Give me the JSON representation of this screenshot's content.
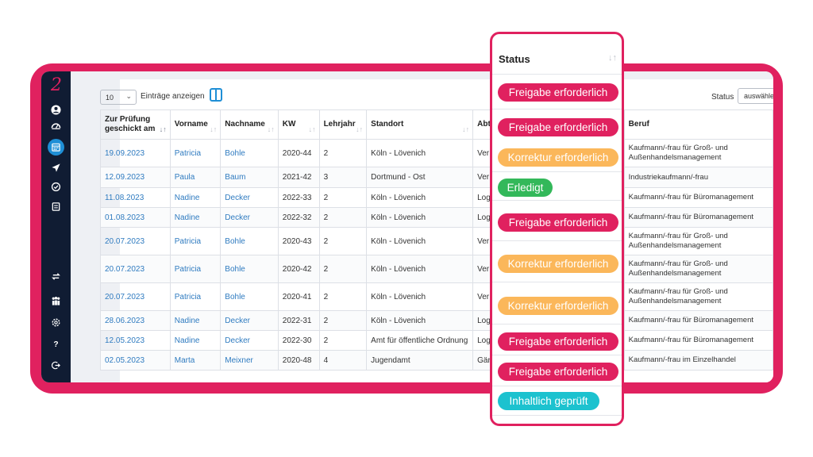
{
  "toolbar": {
    "page_length": "10",
    "page_length_label": "Einträge anzeigen",
    "filter_label": "Status",
    "filter_placeholder": "auswählen"
  },
  "table": {
    "columns": [
      "Zur Prüfung geschickt am",
      "Vorname",
      "Nachname",
      "KW",
      "Lehrjahr",
      "Standort",
      "Abt",
      "Beruf"
    ],
    "rows": [
      {
        "date": "19.09.2023",
        "first": "Patricia",
        "last": "Bohle",
        "kw": "2020-44",
        "year": "2",
        "site": "Köln - Lövenich",
        "dept": "Ver",
        "job": "Kaufmann/-frau für Groß- und Außenhandelsmanagement"
      },
      {
        "date": "12.09.2023",
        "first": "Paula",
        "last": "Baum",
        "kw": "2021-42",
        "year": "3",
        "site": "Dortmund - Ost",
        "dept": "Ver",
        "job": "Industriekaufmann/-frau"
      },
      {
        "date": "11.08.2023",
        "first": "Nadine",
        "last": "Decker",
        "kw": "2022-33",
        "year": "2",
        "site": "Köln - Lövenich",
        "dept": "Log",
        "job": "Kaufmann/-frau für Büromanagement"
      },
      {
        "date": "01.08.2023",
        "first": "Nadine",
        "last": "Decker",
        "kw": "2022-32",
        "year": "2",
        "site": "Köln - Lövenich",
        "dept": "Log",
        "job": "Kaufmann/-frau für Büromanagement"
      },
      {
        "date": "20.07.2023",
        "first": "Patricia",
        "last": "Bohle",
        "kw": "2020-43",
        "year": "2",
        "site": "Köln - Lövenich",
        "dept": "Ver",
        "job": "Kaufmann/-frau für Groß- und Außenhandelsmanagement"
      },
      {
        "date": "20.07.2023",
        "first": "Patricia",
        "last": "Bohle",
        "kw": "2020-42",
        "year": "2",
        "site": "Köln - Lövenich",
        "dept": "Ver",
        "job": "Kaufmann/-frau für Groß- und Außenhandelsmanagement"
      },
      {
        "date": "20.07.2023",
        "first": "Patricia",
        "last": "Bohle",
        "kw": "2020-41",
        "year": "2",
        "site": "Köln - Lövenich",
        "dept": "Ver",
        "job": "Kaufmann/-frau für Groß- und Außenhandelsmanagement"
      },
      {
        "date": "28.06.2023",
        "first": "Nadine",
        "last": "Decker",
        "kw": "2022-31",
        "year": "2",
        "site": "Köln - Lövenich",
        "dept": "Log",
        "job": "Kaufmann/-frau für Büromanagement"
      },
      {
        "date": "12.05.2023",
        "first": "Nadine",
        "last": "Decker",
        "kw": "2022-30",
        "year": "2",
        "site": "Amt für öffentliche Ordnung",
        "dept": "Log",
        "job": "Kaufmann/-frau für Büromanagement"
      },
      {
        "date": "02.05.2023",
        "first": "Marta",
        "last": "Meixner",
        "kw": "2020-48",
        "year": "4",
        "site": "Jugendamt",
        "dept": "Gär",
        "job": "Kaufmann/-frau im Einzelhandel"
      }
    ]
  },
  "status_card": {
    "header": "Status",
    "badges": [
      {
        "label": "Freigabe erforderlich",
        "kind": "red"
      },
      {
        "label": "Freigabe erforderlich",
        "kind": "red"
      },
      {
        "label": "Korrektur erforderlich",
        "kind": "orange"
      },
      {
        "label": "Erledigt",
        "kind": "green"
      },
      {
        "label": "Freigabe erforderlich",
        "kind": "red"
      },
      {
        "label": "Korrektur erforderlich",
        "kind": "orange"
      },
      {
        "label": "Korrektur erforderlich",
        "kind": "orange"
      },
      {
        "label": "Freigabe erforderlich",
        "kind": "red"
      },
      {
        "label": "Freigabe erforderlich",
        "kind": "red"
      },
      {
        "label": "Inhaltlich geprüft",
        "kind": "teal"
      }
    ]
  },
  "colors": {
    "brand_pink": "#e0215f",
    "sidebar": "#101c33",
    "accent_blue": "#1f8fd6",
    "status_red": "#e0215f",
    "status_orange": "#fbb75a",
    "status_green": "#33b85a",
    "status_teal": "#1cc2cf"
  },
  "sidebar_icons": [
    "user-icon",
    "dashboard-icon",
    "calendar-icon",
    "send-icon",
    "check-circle-icon",
    "list-icon",
    "transfer-icon",
    "group-icon",
    "gear-icon",
    "help-icon",
    "logout-icon"
  ]
}
